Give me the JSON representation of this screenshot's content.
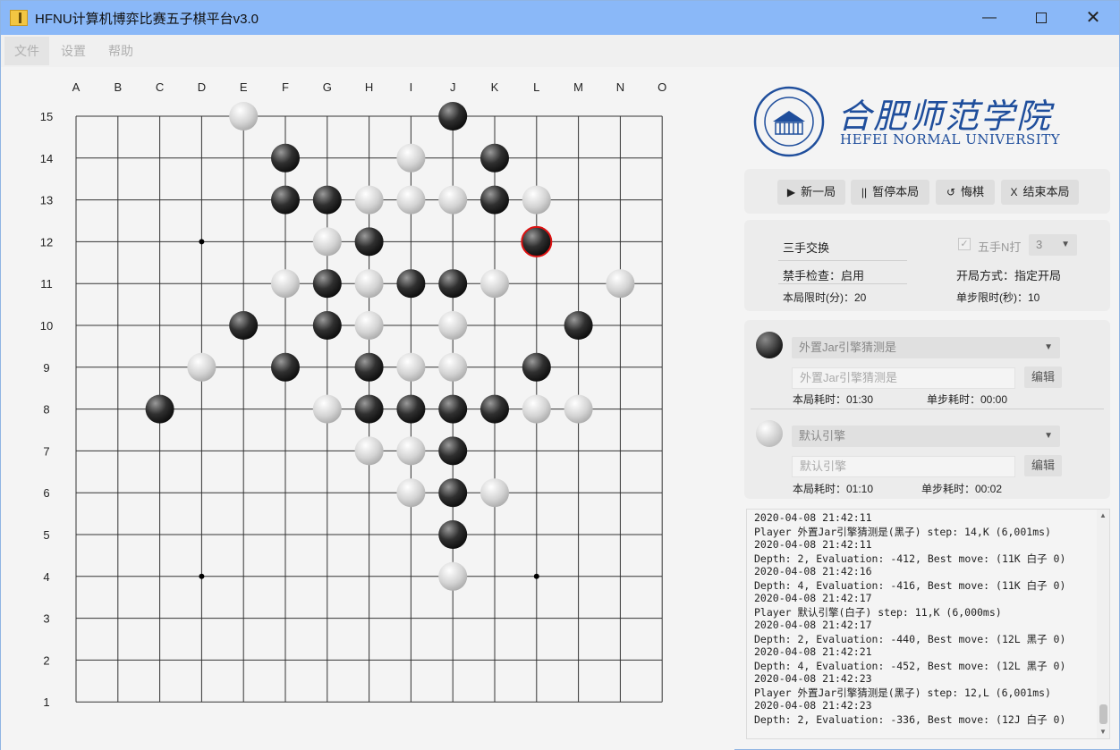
{
  "window": {
    "title": "HFNU计算机博弈比赛五子棋平台v3.0",
    "min_icon": "minimize-icon",
    "max_icon": "maximize-icon",
    "close_icon": "close-icon"
  },
  "menu": [
    "文件",
    "设置",
    "帮助"
  ],
  "board": {
    "columns": [
      "A",
      "B",
      "C",
      "D",
      "E",
      "F",
      "G",
      "H",
      "I",
      "J",
      "K",
      "L",
      "M",
      "N",
      "O"
    ],
    "rows": [
      "15",
      "14",
      "13",
      "12",
      "11",
      "10",
      "9",
      "8",
      "7",
      "6",
      "5",
      "4",
      "3",
      "2",
      "1"
    ],
    "star_points": [
      "D12",
      "D4",
      "L4"
    ],
    "last_move": "L12",
    "stones": [
      {
        "pos": "E15",
        "color": "white"
      },
      {
        "pos": "J15",
        "color": "black"
      },
      {
        "pos": "F14",
        "color": "black"
      },
      {
        "pos": "I14",
        "color": "white"
      },
      {
        "pos": "K14",
        "color": "black"
      },
      {
        "pos": "F13",
        "color": "black"
      },
      {
        "pos": "G13",
        "color": "black"
      },
      {
        "pos": "H13",
        "color": "white"
      },
      {
        "pos": "I13",
        "color": "white"
      },
      {
        "pos": "J13",
        "color": "white"
      },
      {
        "pos": "K13",
        "color": "black"
      },
      {
        "pos": "L13",
        "color": "white"
      },
      {
        "pos": "G12",
        "color": "white"
      },
      {
        "pos": "H12",
        "color": "black"
      },
      {
        "pos": "L12",
        "color": "black"
      },
      {
        "pos": "F11",
        "color": "white"
      },
      {
        "pos": "G11",
        "color": "black"
      },
      {
        "pos": "H11",
        "color": "white"
      },
      {
        "pos": "I11",
        "color": "black"
      },
      {
        "pos": "J11",
        "color": "black"
      },
      {
        "pos": "K11",
        "color": "white"
      },
      {
        "pos": "N11",
        "color": "white"
      },
      {
        "pos": "E10",
        "color": "black"
      },
      {
        "pos": "G10",
        "color": "black"
      },
      {
        "pos": "H10",
        "color": "white"
      },
      {
        "pos": "J10",
        "color": "white"
      },
      {
        "pos": "M10",
        "color": "black"
      },
      {
        "pos": "D9",
        "color": "white"
      },
      {
        "pos": "F9",
        "color": "black"
      },
      {
        "pos": "H9",
        "color": "black"
      },
      {
        "pos": "I9",
        "color": "white"
      },
      {
        "pos": "J9",
        "color": "white"
      },
      {
        "pos": "L9",
        "color": "black"
      },
      {
        "pos": "C8",
        "color": "black"
      },
      {
        "pos": "G8",
        "color": "white"
      },
      {
        "pos": "H8",
        "color": "black"
      },
      {
        "pos": "I8",
        "color": "black"
      },
      {
        "pos": "J8",
        "color": "black"
      },
      {
        "pos": "K8",
        "color": "black"
      },
      {
        "pos": "L8",
        "color": "white"
      },
      {
        "pos": "M8",
        "color": "white"
      },
      {
        "pos": "H7",
        "color": "white"
      },
      {
        "pos": "I7",
        "color": "white"
      },
      {
        "pos": "J7",
        "color": "black"
      },
      {
        "pos": "I6",
        "color": "white"
      },
      {
        "pos": "J6",
        "color": "black"
      },
      {
        "pos": "K6",
        "color": "white"
      },
      {
        "pos": "J5",
        "color": "black"
      },
      {
        "pos": "J4",
        "color": "white"
      }
    ]
  },
  "logo": {
    "cn": "合肥师范学院",
    "en": "HEFEI NORMAL UNIVERSITY",
    "icon": "university-seal-icon"
  },
  "controls": {
    "new_game": "新一局",
    "pause": "暂停本局",
    "undo": "悔棋",
    "end": "结束本局"
  },
  "settings": {
    "swap": "三手交换",
    "five_n_label": "五手N打",
    "five_n_value": "3",
    "forbidden": "禁手检查：启用",
    "opening": "开局方式：指定开局",
    "time_limit": "本局限时(分)：20",
    "step_limit": "单步限时(秒)：10"
  },
  "black_player": {
    "engine": "外置Jar引擎猜测是",
    "path_placeholder": "外置Jar引擎猜测是",
    "edit": "编辑",
    "total_time": "本局耗时：01:30",
    "step_time": "单步耗时：00:00"
  },
  "white_player": {
    "engine": "默认引擎",
    "path_placeholder": "默认引擎",
    "edit": "编辑",
    "total_time": "本局耗时：01:10",
    "step_time": "单步耗时：00:02"
  },
  "log": [
    "2020-04-08 21:42:11",
    " Player 外置Jar引擎猜测是(黑子) step: 14,K (6,001ms)",
    "2020-04-08 21:42:11",
    " Depth: 2, Evaluation: -412, Best move: (11K 白子 0)",
    "2020-04-08 21:42:16",
    " Depth: 4, Evaluation: -416, Best move: (11K 白子 0)",
    "2020-04-08 21:42:17",
    " Player 默认引擎(白子) step: 11,K (6,000ms)",
    "2020-04-08 21:42:17",
    " Depth: 2, Evaluation: -440, Best move: (12L 黑子 0)",
    "2020-04-08 21:42:21",
    " Depth: 4, Evaluation: -452, Best move: (12L 黑子 0)",
    "2020-04-08 21:42:23",
    " Player 外置Jar引擎猜测是(黑子) step: 12,L (6,001ms)",
    "2020-04-08 21:42:23",
    " Depth: 2, Evaluation: -336, Best move: (12J 白子 0)"
  ]
}
